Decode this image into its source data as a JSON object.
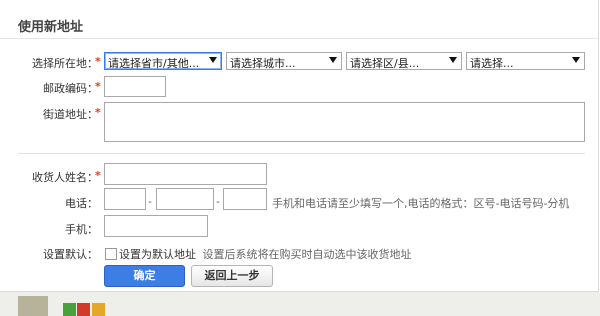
{
  "title": "使用新地址",
  "region": {
    "label": "选择所在地：",
    "province": "请选择省市/其他...",
    "city": "请选择城市...",
    "district": "请选择区/县...",
    "street": "请选择..."
  },
  "postcode": {
    "label": "邮政编码："
  },
  "street_address": {
    "label": "街道地址："
  },
  "recipient": {
    "label": "收货人姓名："
  },
  "phone": {
    "label": "电话：",
    "separator": "-",
    "hint": "手机和电话请至少填写一个,电话的格式：区号-电话号码-分机"
  },
  "mobile": {
    "label": "手机："
  },
  "default": {
    "label": "设置默认：",
    "checkbox_label": "设置为默认地址",
    "hint": "设置后系统将在购买时自动选中该收货地址"
  },
  "buttons": {
    "confirm": "确定",
    "back": "返回上一步"
  },
  "required_mark": "*",
  "colors": {
    "primary": "#3d7de6",
    "required": "#e03c1f"
  }
}
